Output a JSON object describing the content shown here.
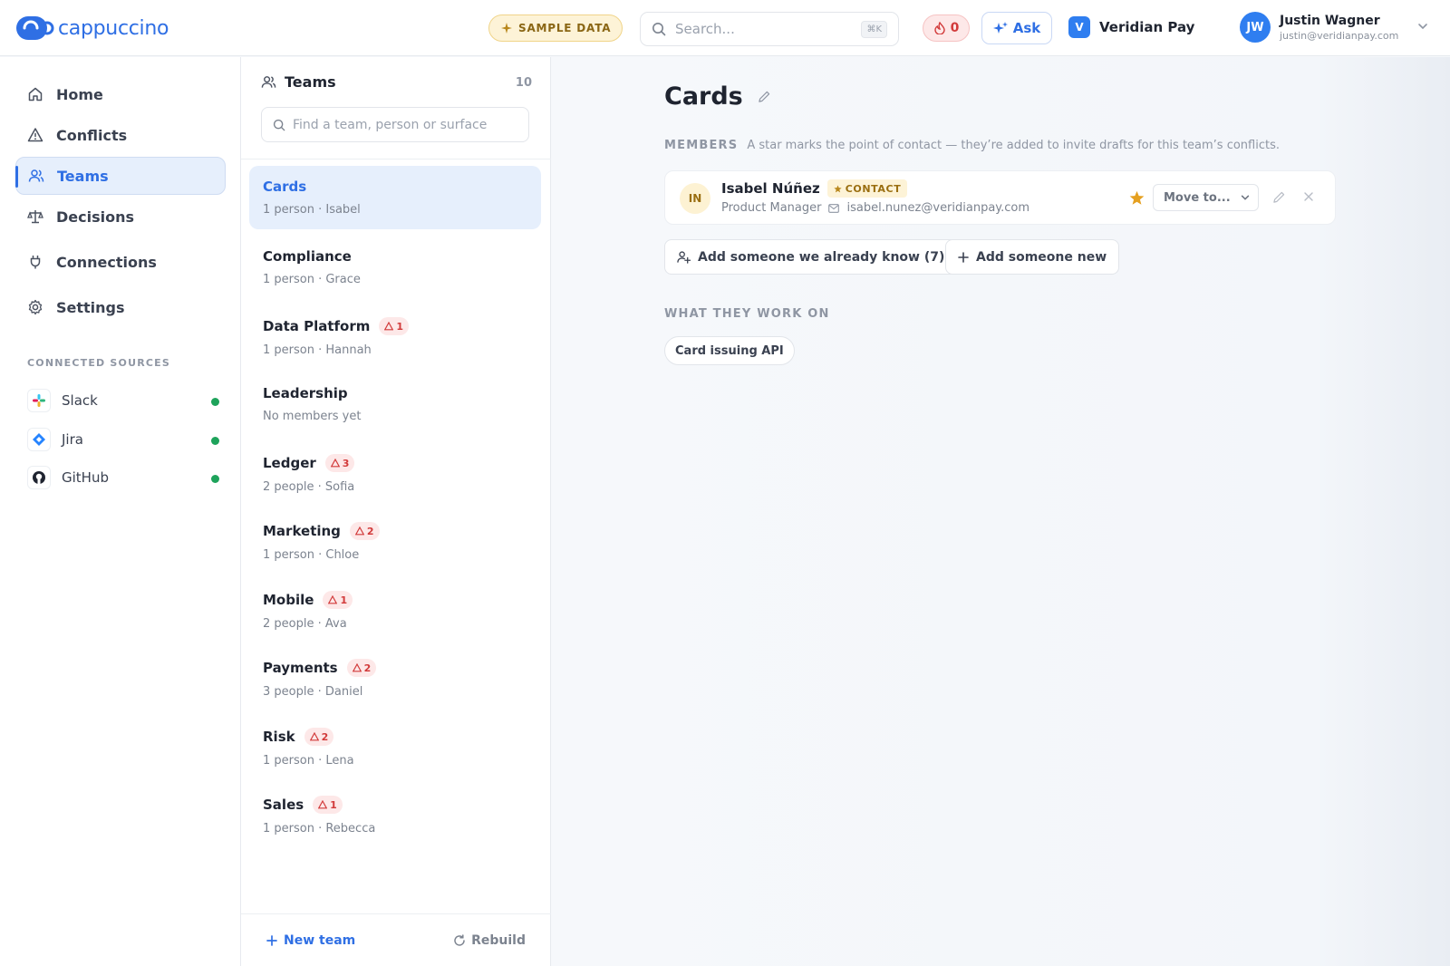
{
  "app": {
    "logo_text": "cappuccino",
    "brand_color": "#2f6fe4"
  },
  "topbar": {
    "sample_badge": "SAMPLE DATA",
    "search_placeholder": "Search...",
    "search_shortcut": "⌘K",
    "conflict_count": "0",
    "ask_label": "Ask",
    "org": {
      "initial": "V",
      "name": "Veridian Pay"
    },
    "user": {
      "initials": "JW",
      "name": "Justin Wagner",
      "email": "justin@veridianpay.com"
    }
  },
  "sidebar": {
    "items": [
      {
        "label": "Home",
        "icon": "home-icon"
      },
      {
        "label": "Conflicts",
        "icon": "warning-icon"
      },
      {
        "label": "Teams",
        "icon": "users-icon",
        "active": true
      },
      {
        "label": "Decisions",
        "icon": "scale-icon"
      },
      {
        "label": "Connections",
        "icon": "plug-icon"
      },
      {
        "label": "Settings",
        "icon": "gear-icon"
      }
    ],
    "sources_label": "CONNECTED SOURCES",
    "sources": [
      {
        "label": "Slack",
        "icon": "slack-icon",
        "status": "connected"
      },
      {
        "label": "Jira",
        "icon": "jira-icon",
        "status": "connected"
      },
      {
        "label": "GitHub",
        "icon": "github-icon",
        "status": "connected"
      }
    ]
  },
  "teams": {
    "title": "Teams",
    "count": "10",
    "search_placeholder": "Find a team, person or surface",
    "list": [
      {
        "name": "Cards",
        "sub": "1 person · Isabel",
        "conflicts": "",
        "active": true
      },
      {
        "name": "Compliance",
        "sub": "1 person · Grace",
        "conflicts": ""
      },
      {
        "name": "Data Platform",
        "sub": "1 person · Hannah",
        "conflicts": "1"
      },
      {
        "name": "Leadership",
        "sub": "No members yet",
        "conflicts": ""
      },
      {
        "name": "Ledger",
        "sub": "2 people · Sofia",
        "conflicts": "3"
      },
      {
        "name": "Marketing",
        "sub": "1 person · Chloe",
        "conflicts": "2"
      },
      {
        "name": "Mobile",
        "sub": "2 people · Ava",
        "conflicts": "1"
      },
      {
        "name": "Payments",
        "sub": "3 people · Daniel",
        "conflicts": "2"
      },
      {
        "name": "Risk",
        "sub": "1 person · Lena",
        "conflicts": "2"
      },
      {
        "name": "Sales",
        "sub": "1 person · Rebecca",
        "conflicts": "1"
      }
    ],
    "new_team_label": "New team",
    "rebuild_label": "Rebuild"
  },
  "main": {
    "title": "Cards",
    "members_label": "MEMBERS",
    "members_hint": "A star marks the point of contact — they’re added to invite drafts for this team’s conflicts.",
    "member": {
      "initials": "IN",
      "name": "Isabel Núñez",
      "badge": "CONTACT",
      "role": "Product Manager",
      "email": "isabel.nunez@veridianpay.com",
      "move_label": "Move to..."
    },
    "add_known_label": "Add someone we already know (7)",
    "add_new_label": "Add someone new",
    "work_label": "WHAT THEY WORK ON",
    "surfaces": [
      "Card issuing API"
    ]
  }
}
